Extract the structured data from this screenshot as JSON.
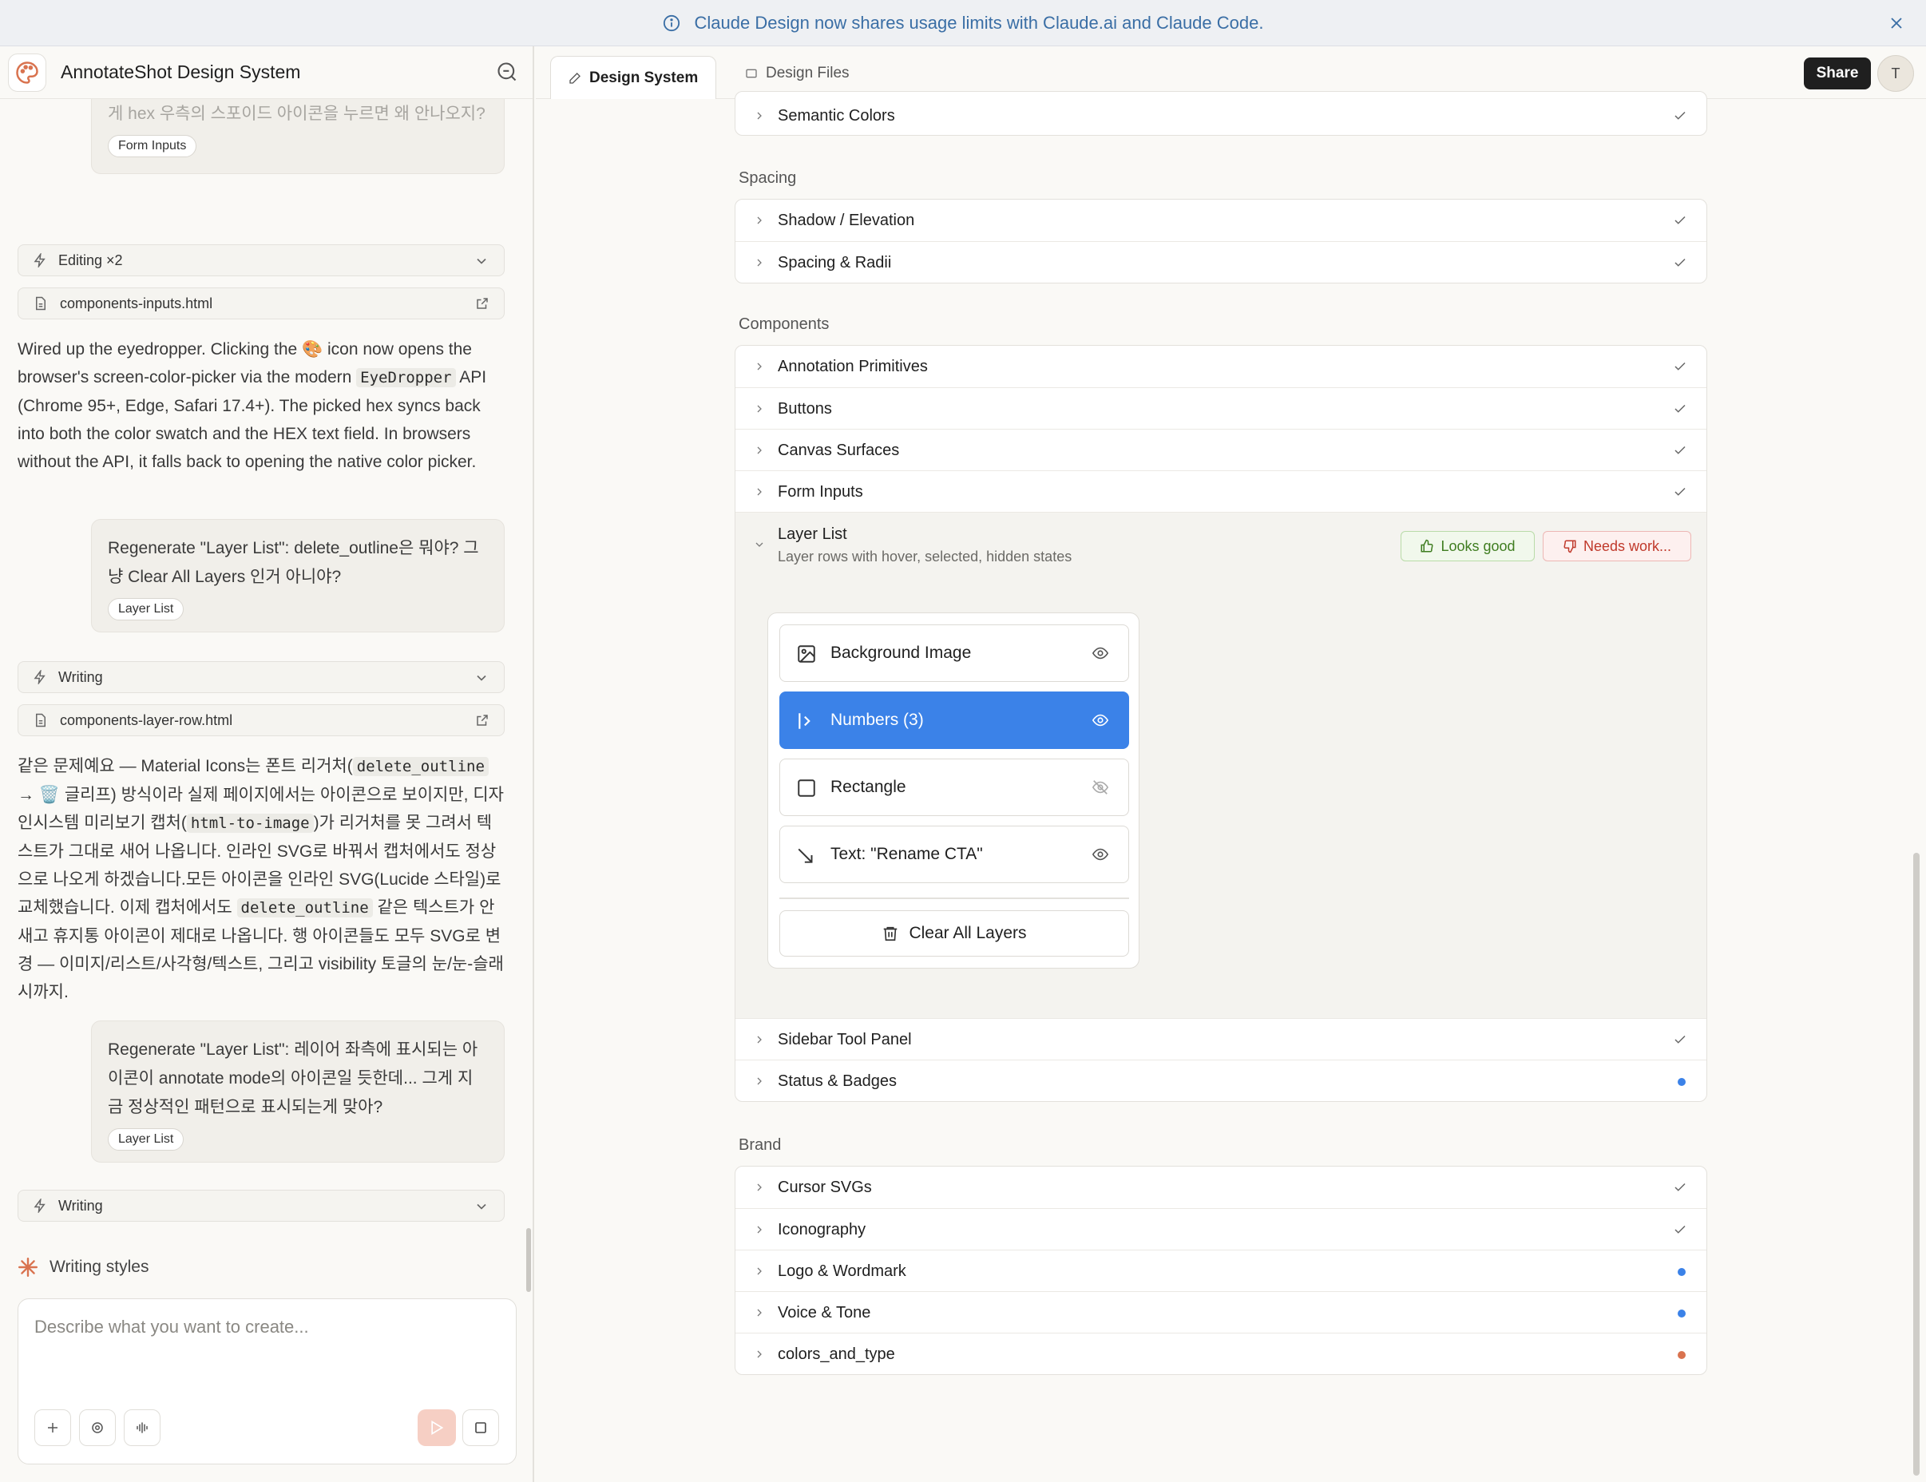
{
  "banner": {
    "text": "Claude Design now shares usage limits with Claude.ai and Claude Code."
  },
  "app": {
    "title": "AnnotateShot Design System"
  },
  "chat": {
    "top_fragment": "게 hex 우측의 스포이드 아이콘을 누르면 왜 안나오지?",
    "top_tag": "Form Inputs",
    "tool1": "Editing ×2",
    "file1": "components-inputs.html",
    "para1": {
      "a": "Wired up the eyedropper. Clicking the 🎨 icon now opens the browser's screen-color-picker via the modern ",
      "code": "EyeDropper",
      "b": " API (Chrome 95+, Edge, Safari 17.4+). The picked hex syncs back into both the color swatch and the HEX text field. In browsers without the API, it falls back to opening the native color picker."
    },
    "msg2": {
      "text": "Regenerate \"Layer List\": delete_outline은 뭐야? 그냥 Clear All Layers 인거 아니야?",
      "tag": "Layer List"
    },
    "tool2": "Writing",
    "file2": "components-layer-row.html",
    "para2": {
      "a": "같은 문제예요 — Material Icons는 폰트 리거처(",
      "code1": "delete_outline",
      "b": " → 🗑️ 글리프) 방식이라 실제 페이지에서는 아이콘으로 보이지만, 디자인시스템 미리보기 캡처(",
      "code2": "html-to-image",
      "c": ")가 리거처를 못 그려서 텍스트가 그대로 새어 나옵니다. 인라인 SVG로 바꿔서 캡처에서도 정상으로 나오게 하겠습니다.모든 아이콘을 인라인 SVG(Lucide 스타일)로 교체했습니다. 이제 캡처에서도 ",
      "code3": "delete_outline",
      "d": " 같은 텍스트가 안 새고 휴지통 아이콘이 제대로 나옵니다. 행 아이콘들도 모두 SVG로 변경 — 이미지/리스트/사각형/텍스트, 그리고 visibility 토글의 눈/눈-슬래시까지."
    },
    "msg3": {
      "text": "Regenerate \"Layer List\": 레이어 좌측에 표시되는 아이콘이 annotate mode의 아이콘일 듯한데... 그게 지금 정상적인 패턴으로 표시되는게 맞아?",
      "tag": "Layer List"
    },
    "tool3": "Writing",
    "writing_styles": "Writing styles",
    "composer_placeholder": "Describe what you want to create..."
  },
  "tabs": {
    "design_system": "Design System",
    "design_files": "Design Files"
  },
  "share": "Share",
  "avatar": "T",
  "sections": {
    "semantic_colors": "Semantic Colors",
    "spacing_title": "Spacing",
    "spacing": [
      "Shadow / Elevation",
      "Spacing & Radii"
    ],
    "components_title": "Components",
    "components": [
      "Annotation Primitives",
      "Buttons",
      "Canvas Surfaces",
      "Form Inputs"
    ],
    "layer_list": {
      "title": "Layer List",
      "subtitle": "Layer rows with hover, selected, hidden states",
      "looks_good": "Looks good",
      "needs_work": "Needs work..."
    },
    "components_after": [
      "Sidebar Tool Panel",
      "Status & Badges"
    ],
    "brand_title": "Brand",
    "brand": [
      "Cursor SVGs",
      "Iconography",
      "Logo & Wordmark",
      "Voice & Tone",
      "colors_and_type"
    ]
  },
  "layers": [
    {
      "name": "Background Image",
      "icon": "image-icon",
      "visible": true,
      "selected": false
    },
    {
      "name": "Numbers (3)",
      "icon": "numbers-icon",
      "visible": true,
      "selected": true
    },
    {
      "name": "Rectangle",
      "icon": "square-icon",
      "visible": false,
      "selected": false
    },
    {
      "name": "Text: \"Rename CTA\"",
      "icon": "text-arrow-icon",
      "visible": true,
      "selected": false
    }
  ],
  "clear_all": "Clear All Layers",
  "colors": {
    "accent_blue": "#3b82e8",
    "dot_blue": "#3b82e8",
    "dot_orange": "#d9734f",
    "good": "#3f7d20",
    "bad": "#c0392b"
  }
}
